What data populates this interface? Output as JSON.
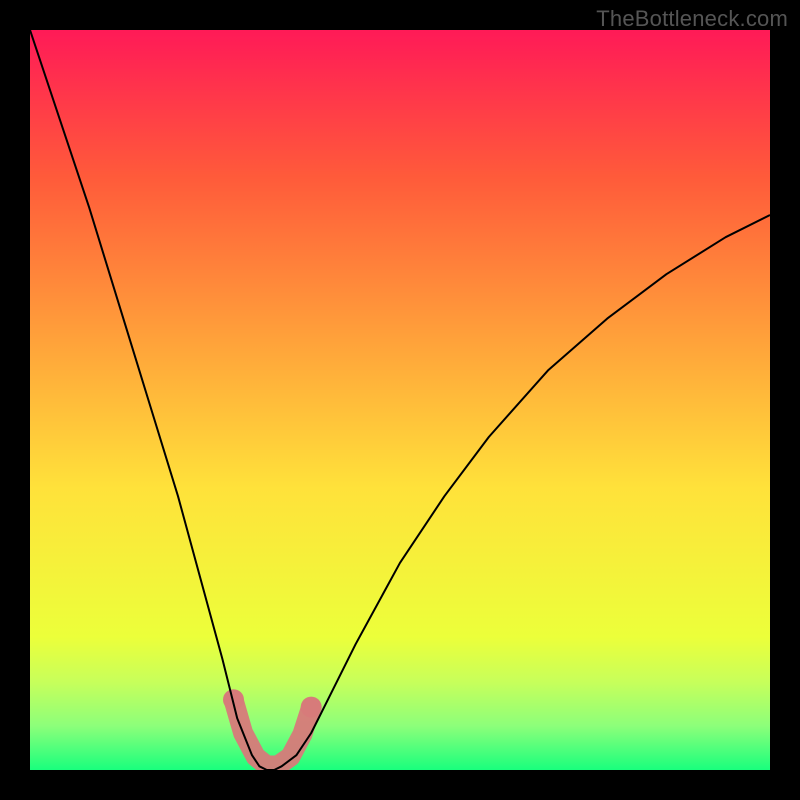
{
  "watermark_text": "TheBottleneck.com",
  "chart_data": {
    "type": "line",
    "title": "",
    "xlabel": "",
    "ylabel": "",
    "xlim": [
      0,
      100
    ],
    "ylim": [
      0,
      100
    ],
    "grid": false,
    "background": {
      "type": "vertical-gradient",
      "stops": [
        {
          "offset": 0.0,
          "color": "#ff1a57"
        },
        {
          "offset": 0.2,
          "color": "#ff5b3a"
        },
        {
          "offset": 0.42,
          "color": "#ffa23a"
        },
        {
          "offset": 0.62,
          "color": "#ffe23a"
        },
        {
          "offset": 0.82,
          "color": "#ecff3a"
        },
        {
          "offset": 0.88,
          "color": "#c8ff5a"
        },
        {
          "offset": 0.94,
          "color": "#8dff7a"
        },
        {
          "offset": 1.0,
          "color": "#19ff7d"
        }
      ]
    },
    "series": [
      {
        "name": "bottleneck-curve",
        "stroke": "#000000",
        "stroke_width": 2,
        "x": [
          0,
          4,
          8,
          12,
          16,
          20,
          23,
          26,
          28,
          30,
          31,
          32,
          33,
          34,
          36,
          38,
          40,
          44,
          50,
          56,
          62,
          70,
          78,
          86,
          94,
          100
        ],
        "y": [
          100,
          88,
          76,
          63,
          50,
          37,
          26,
          15,
          7,
          2,
          0.5,
          0,
          0,
          0.5,
          2,
          5,
          9,
          17,
          28,
          37,
          45,
          54,
          61,
          67,
          72,
          75
        ]
      }
    ],
    "markers": [
      {
        "name": "highlight-band",
        "shape": "blob",
        "color": "#d77a7a",
        "points": [
          {
            "x": 27.5,
            "y": 9.5
          },
          {
            "x": 28.8,
            "y": 5.0
          },
          {
            "x": 30.5,
            "y": 1.8
          },
          {
            "x": 32.0,
            "y": 0.6
          },
          {
            "x": 33.5,
            "y": 0.6
          },
          {
            "x": 35.2,
            "y": 1.8
          },
          {
            "x": 36.8,
            "y": 4.8
          },
          {
            "x": 38.0,
            "y": 8.5
          }
        ],
        "radius": 10
      }
    ]
  }
}
